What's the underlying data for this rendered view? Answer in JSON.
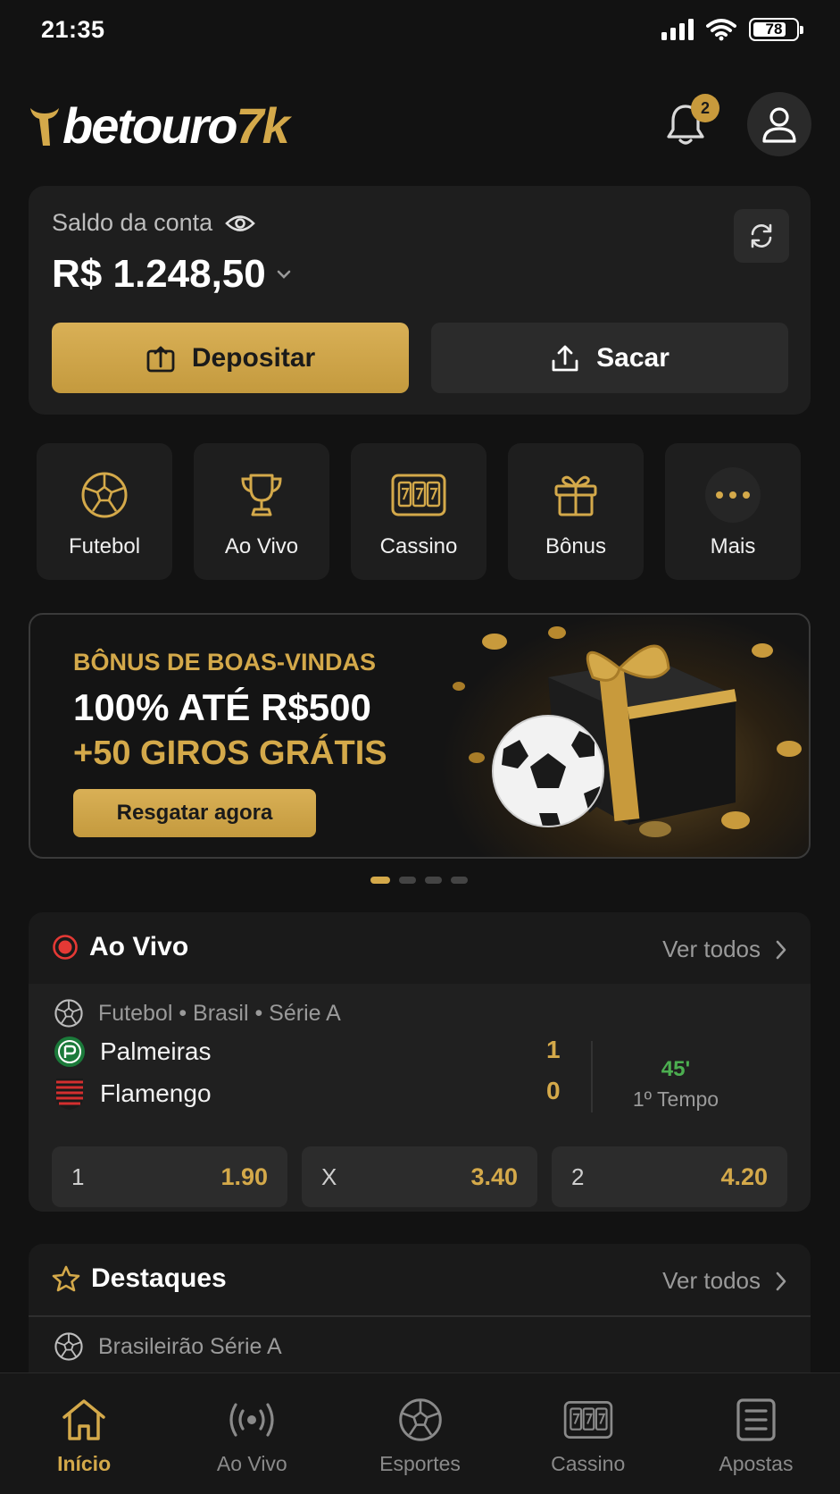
{
  "status_bar": {
    "time": "21:35",
    "battery": "78"
  },
  "header": {
    "logo_white": "betouro",
    "logo_gold": "7k",
    "notification_count": "2"
  },
  "balance": {
    "label": "Saldo da conta",
    "value": "R$ 1.248,50",
    "deposit_label": "Depositar",
    "withdraw_label": "Sacar"
  },
  "quick_nav": [
    {
      "label": "Futebol",
      "icon": "soccer-ball-icon"
    },
    {
      "label": "Ao Vivo",
      "icon": "trophy-icon"
    },
    {
      "label": "Cassino",
      "icon": "slot-machine-icon"
    },
    {
      "label": "Bônus",
      "icon": "gift-icon"
    },
    {
      "label": "Mais",
      "icon": "more-dots-icon"
    }
  ],
  "banner": {
    "kicker": "BÔNUS DE BOAS-VINDAS",
    "headline": "100% ATÉ R$500",
    "subline": "+50 GIROS GRÁTIS",
    "cta": "Resgatar agora",
    "slides": 4,
    "active_slide": 1
  },
  "live": {
    "title": "Ao Vivo",
    "see_all": "Ver todos",
    "match": {
      "league": "Futebol • Brasil • Série A",
      "home": {
        "name": "Palmeiras",
        "score": "1"
      },
      "away": {
        "name": "Flamengo",
        "score": "0"
      },
      "minute": "45'",
      "period": "1º Tempo",
      "odds": [
        {
          "label": "1",
          "value": "1.90"
        },
        {
          "label": "X",
          "value": "3.40"
        },
        {
          "label": "2",
          "value": "4.20"
        }
      ]
    }
  },
  "highlights": {
    "title": "Destaques",
    "see_all": "Ver todos",
    "league": "Brasileirão Série A"
  },
  "tabbar": [
    {
      "label": "Início",
      "icon": "home-icon",
      "active": true
    },
    {
      "label": "Ao Vivo",
      "icon": "live-broadcast-icon",
      "active": false
    },
    {
      "label": "Esportes",
      "icon": "soccer-ball-icon",
      "active": false
    },
    {
      "label": "Cassino",
      "icon": "slot-machine-icon",
      "active": false
    },
    {
      "label": "Apostas",
      "icon": "bet-slip-icon",
      "active": false
    }
  ],
  "colors": {
    "accent": "#d4a94a",
    "background": "#121212",
    "card": "#1e1e1e",
    "live_green": "#4caf50",
    "live_red": "#e53935"
  }
}
